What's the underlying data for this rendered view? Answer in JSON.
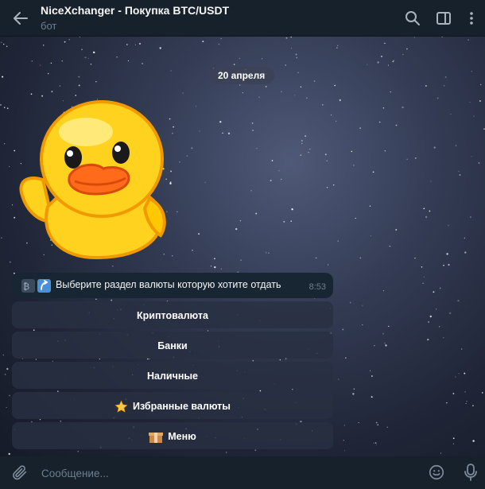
{
  "header": {
    "title": "NiceXchanger - Покупка BTC/USDT",
    "subtitle": "бот"
  },
  "chat": {
    "date_badge": "20 апреля",
    "sticker": "duck-waving",
    "message": {
      "text": "Выберите раздел валюты которую хотите отдать",
      "time": "8:53"
    },
    "keyboard": [
      {
        "label": "Криптовалюта"
      },
      {
        "label": "Банки"
      },
      {
        "label": "Наличные"
      },
      {
        "label": "Избранные валюты",
        "icon": "star-icon"
      },
      {
        "label": "Меню",
        "icon": "box-icon"
      }
    ]
  },
  "composer": {
    "placeholder": "Сообщение..."
  },
  "colors": {
    "header_bg": "#17212b",
    "bubble_bg": "#182533",
    "text_muted": "#6d7f8f"
  }
}
